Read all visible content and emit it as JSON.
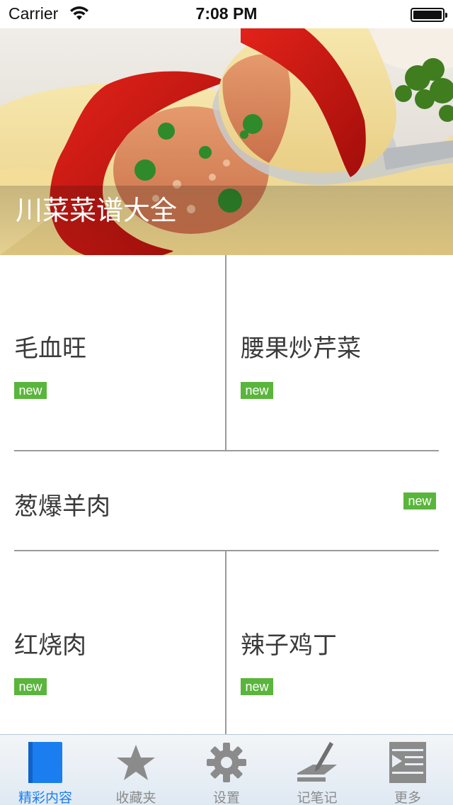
{
  "status_bar": {
    "carrier": "Carrier",
    "time": "7:08 PM"
  },
  "hero": {
    "title": "川菜菜谱大全"
  },
  "recipes": [
    {
      "name": "毛血旺",
      "badge": "new"
    },
    {
      "name": "腰果炒芹菜",
      "badge": "new"
    },
    {
      "name": "葱爆羊肉",
      "badge": "new"
    },
    {
      "name": "红烧肉",
      "badge": "new"
    },
    {
      "name": "辣子鸡丁",
      "badge": "new"
    }
  ],
  "tab_bar": {
    "active_color": "#1a7ef0",
    "inactive_color": "#8b8b8b",
    "tabs": [
      {
        "label": "精彩内容",
        "icon": "document-icon",
        "active": true
      },
      {
        "label": "收藏夹",
        "icon": "star-icon",
        "active": false
      },
      {
        "label": "设置",
        "icon": "gear-icon",
        "active": false
      },
      {
        "label": "记笔记",
        "icon": "pen-note-icon",
        "active": false
      },
      {
        "label": "更多",
        "icon": "list-more-icon",
        "active": false
      }
    ]
  },
  "colors": {
    "badge": "#5ab53c",
    "divider": "#9a9a9a"
  }
}
